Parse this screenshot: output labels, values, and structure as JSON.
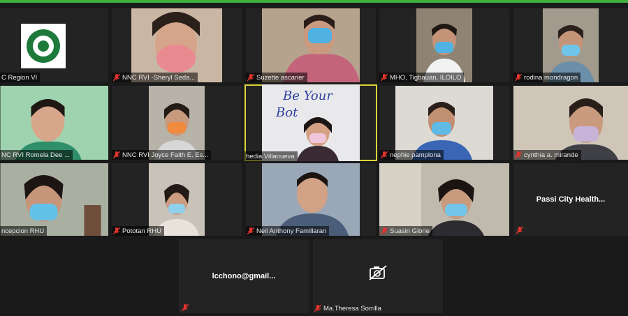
{
  "colors": {
    "active_border": "#d9d43b",
    "muted_mic": "#e5342c",
    "tile_bg": "#232323"
  },
  "participants": [
    {
      "name": "C Region VI"
    },
    {
      "name": "NNC RVI -Sheryl Seda..."
    },
    {
      "name": "Suzette ascaner"
    },
    {
      "name": "MHO, Tigbauan, ILOILO"
    },
    {
      "name": "rodina mondragon"
    },
    {
      "name": "NC RVI Romela Dee ..."
    },
    {
      "name": "NNC RVI Joyce Faith E. Es..."
    },
    {
      "name": "hedia Villanueva"
    },
    {
      "name": "nephie pamplona"
    },
    {
      "name": "cynthia a. mirande"
    },
    {
      "name": "ncepcion RHU"
    },
    {
      "name": "Pototan RHU"
    },
    {
      "name": "Neil Anthony Famillaran"
    },
    {
      "name": "Suasin Glorie"
    },
    {
      "name": "Passi City Health..."
    },
    {
      "name": "lcchono@gmail..."
    },
    {
      "name": "Ma.Theresa Sorrilla"
    }
  ]
}
